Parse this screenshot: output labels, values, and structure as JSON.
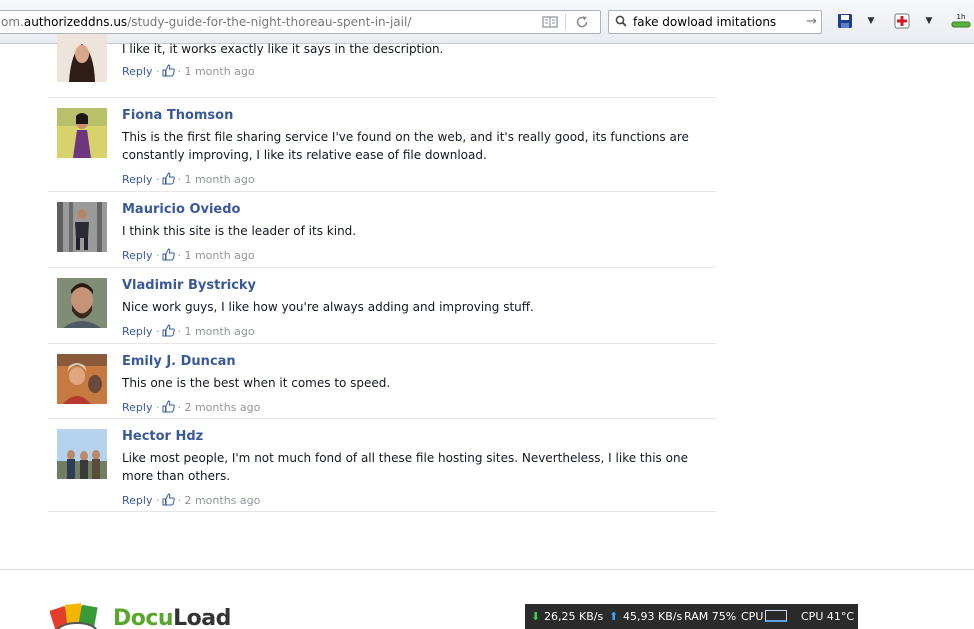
{
  "browser": {
    "url_prefix": "om.",
    "url_host": "authorizeddns.us",
    "url_path": "/study-guide-for-the-night-thoreau-spent-in-jail/",
    "search_value": "fake dowload imitations",
    "download_label": "1h"
  },
  "comments": [
    {
      "name": "",
      "text": "I like it, it works exactly like it says in the description.",
      "reply": "Reply",
      "time": "1 month ago"
    },
    {
      "name": "Fiona Thomson",
      "text": "This is the first file sharing service I've found on the web, and it's really good, its functions are constantly improving, I like its relative ease of file download.",
      "reply": "Reply",
      "time": "1 month ago"
    },
    {
      "name": "Mauricio Oviedo",
      "text": "I think this site is the leader of its kind.",
      "reply": "Reply",
      "time": "1 month ago"
    },
    {
      "name": "Vladimir Bystricky",
      "text": "Nice work guys, I like how you're always adding and improving stuff.",
      "reply": "Reply",
      "time": "1 month ago"
    },
    {
      "name": "Emily J. Duncan",
      "text": "This one is the best when it comes to speed.",
      "reply": "Reply",
      "time": "2 months ago"
    },
    {
      "name": "Hector Hdz",
      "text": "Like most people, I'm not much fond of all these file hosting sites. Nevertheless, I like this one more than others.",
      "reply": "Reply",
      "time": "2 months ago"
    }
  ],
  "footer": {
    "logo_part1": "Docu",
    "logo_part2": "Load"
  },
  "sysmon": {
    "down": "26,25 KB/s",
    "up": "45,93 KB/s",
    "ram": "RAM 75%",
    "cpu_label": "CPU",
    "cpu_temp": "CPU 41°C"
  },
  "colors": {
    "name_link": "#3b5998",
    "logo_green": "#5aa52c"
  }
}
